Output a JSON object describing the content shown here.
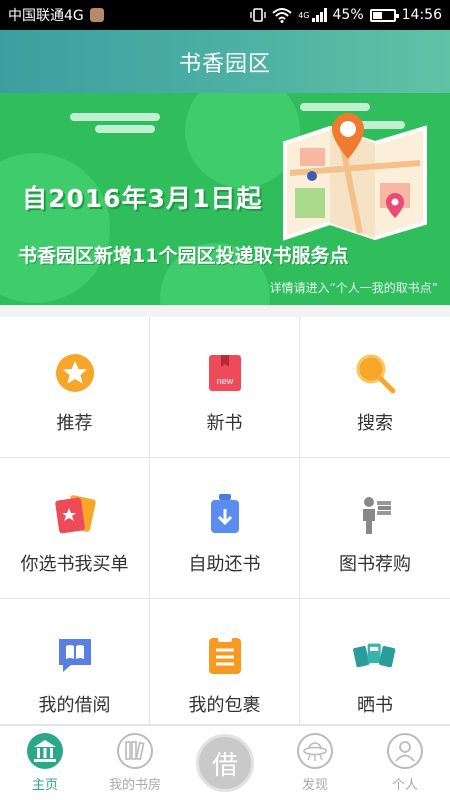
{
  "status_bar": {
    "carrier": "中国联通4G",
    "network": "4G",
    "battery": "45%",
    "battery_level": 0.45,
    "time": "14:56"
  },
  "header": {
    "title": "书香园区"
  },
  "banner": {
    "line1": "自2016年3月1日起",
    "line2": "书香园区新增11个园区投递取书服务点",
    "note": "详情请进入“个人一我的取书点”"
  },
  "grid": {
    "items": [
      {
        "label": "推荐",
        "icon": "star-icon"
      },
      {
        "label": "新书",
        "icon": "new-book-icon"
      },
      {
        "label": "搜索",
        "icon": "search-icon"
      },
      {
        "label": "你选书我买单",
        "icon": "book-card-icon"
      },
      {
        "label": "自助还书",
        "icon": "return-box-icon"
      },
      {
        "label": "图书荐购",
        "icon": "person-books-icon"
      },
      {
        "label": "我的借阅",
        "icon": "book-chat-icon"
      },
      {
        "label": "我的包裹",
        "icon": "clipboard-icon"
      },
      {
        "label": "晒书",
        "icon": "share-books-icon"
      }
    ]
  },
  "tab_bar": {
    "home": "主页",
    "bookroom": "我的书房",
    "borrow": "借",
    "discover": "发现",
    "profile": "个人"
  },
  "colors": {
    "header": "#4fb3a4",
    "banner": "#2fbe5b",
    "accent": "#2ba88a"
  }
}
